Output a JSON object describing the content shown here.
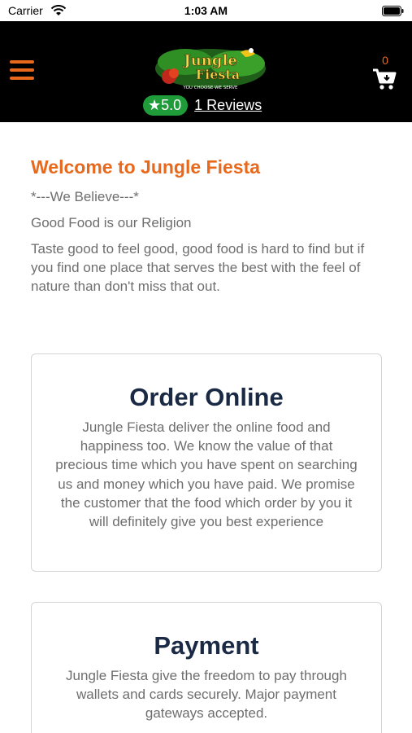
{
  "status_bar": {
    "carrier": "Carrier",
    "time": "1:03 AM"
  },
  "header": {
    "menu_icon": "hamburger-menu-icon",
    "logo_alt": "Jungle Fiesta",
    "logo_brand_line1": "Jungle",
    "logo_brand_line2": "Fiesta",
    "logo_tagline": "YOU CHOOSE WE SERVE",
    "rating": "★5.0",
    "reviews": "1 Reviews",
    "cart_count": "0",
    "cart_icon": "shopping-cart-icon",
    "accent_color": "#e8681c",
    "rating_color": "#1f9b3a"
  },
  "intro": {
    "title": "Welcome to Jungle Fiesta",
    "subtitle": "*---We Believe---*",
    "motto": "Good Food is our Religion",
    "body": "Taste good to feel good, good food is hard to find but if you find one place that serves the best with the feel of nature than don't miss that out."
  },
  "cards": {
    "order": {
      "title": "Order Online",
      "text": "Jungle Fiesta deliver the online food and happiness too. We know the value of that precious time which you have spent on searching us and money which you have paid. We promise the customer that the food which order by you it will definitely give you best experience"
    },
    "payment": {
      "title": "Payment",
      "text": "Jungle Fiesta give the freedom to pay through wallets and cards securely. Major payment gateways accepted."
    }
  }
}
